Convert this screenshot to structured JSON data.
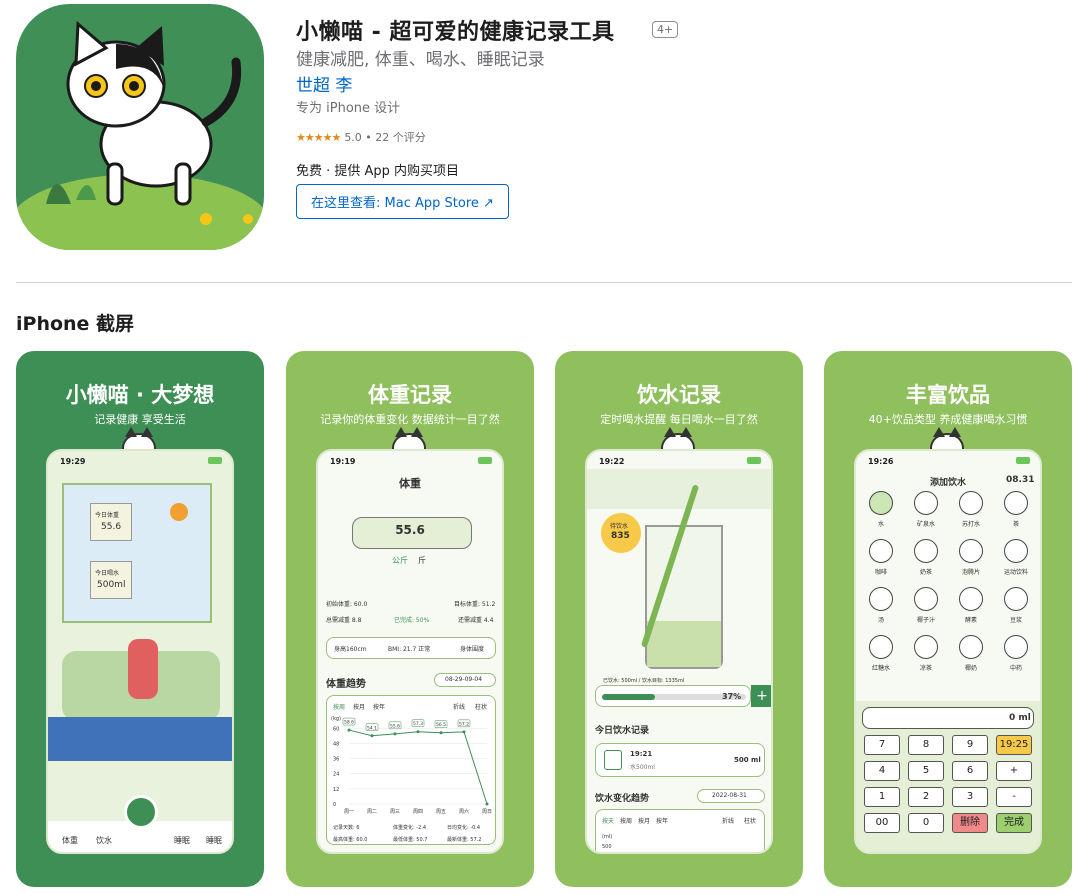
{
  "app": {
    "title": "小懒喵 - 超可爱的健康记录工具",
    "age_rating": "4+",
    "subtitle": "健康减肥, 体重、喝水、睡眠记录",
    "developer": "世超 李",
    "designed_for": "专为 iPhone 设计",
    "stars": "★★★★★",
    "rating_text": "5.0 • 22 个评分",
    "price_text": "免费 · 提供 App 内购买项目",
    "mac_store_button": "在这里查看: Mac App Store ↗"
  },
  "section_title": "iPhone 截屏",
  "screenshots": [
    {
      "title": "小懒喵 · 大梦想",
      "subtitle": "记录健康  享受生活",
      "time": "19:29",
      "note1_label": "今日体重",
      "note1_value": "55.6",
      "note2_label": "今日喝水",
      "note2_value": "500ml",
      "tabs": [
        "体重",
        "饮水",
        "",
        "睡眠",
        "睡眠"
      ]
    },
    {
      "title": "体重记录",
      "subtitle": "记录你的体重变化  数据统计一目了然",
      "time": "19:19",
      "header": "体重",
      "weight_value": "55.6",
      "unit_kg": "公斤",
      "unit_jin": "斤",
      "initial_weight": "初始体重: 60.0",
      "target_weight": "目标体重: 51.2",
      "total_loss": "总需减重 8.8",
      "remaining_loss": "还需减重 4.4",
      "completed": "已完成: 50%",
      "height": "身高160cm",
      "bmi": "BMI: 21.7 正常",
      "body_fat": "身体围度",
      "trend_title": "体重趋势",
      "trend_date": "08-29-09-04",
      "range_tabs": [
        "按周",
        "按月",
        "按年"
      ],
      "chart_tabs": [
        "折线",
        "柱状"
      ],
      "bottom_stats": [
        "记录天数: 6",
        "体重变化: -2.4",
        "日均变化: -0.4",
        "最高体重: 60.0",
        "最低体重: 50.7",
        "最新体重: 57.2"
      ]
    },
    {
      "title": "饮水记录",
      "subtitle": "定时喝水提醒  每日喝水一目了然",
      "time": "19:22",
      "bubble_label": "待饮水",
      "bubble_value": "835",
      "progress_text": "已饮水: 500ml / 饮水目标: 1335ml",
      "progress_pct": "37%",
      "today_title": "今日饮水记录",
      "record_time": "19:21",
      "record_name": "水500ml",
      "record_amount": "500 ml",
      "trend_title": "饮水变化趋势",
      "trend_date": "2022-08-31",
      "range_tabs": [
        "按天",
        "按周",
        "按月",
        "按年"
      ],
      "chart_tabs": [
        "折线",
        "柱状"
      ],
      "axis_unit": "(ml)",
      "axis_val": "500"
    },
    {
      "title": "丰富饮品",
      "subtitle": "40+饮品类型  养成健康喝水习惯",
      "time": "19:26",
      "header": "添加饮水",
      "date": "08.31",
      "drinks": [
        "水",
        "矿泉水",
        "苏打水",
        "茶",
        "咖啡",
        "奶茶",
        "泡腾片",
        "运动饮料",
        "汤",
        "椰子汁",
        "酵素",
        "豆浆",
        "红糖水",
        "凉茶",
        "椰奶",
        "中药"
      ],
      "amount": "0 ml",
      "keys": [
        "7",
        "8",
        "9",
        "19:25",
        "4",
        "5",
        "6",
        "+",
        "1",
        "2",
        "3",
        "-",
        "00",
        "0",
        "删除",
        "完成"
      ]
    }
  ],
  "colors": {
    "dark_green": "#3d8f55",
    "light_green": "#8fc05d",
    "link_blue": "#0066cc"
  },
  "chart_data": {
    "type": "line",
    "ylabel": "(kg)",
    "categories": [
      "周一",
      "周二",
      "周三",
      "周四",
      "周五",
      "周六",
      "周日"
    ],
    "values": [
      58.6,
      54.1,
      55.6,
      57.3,
      56.5,
      57.2,
      0
    ],
    "yticks": [
      0,
      12,
      24,
      36,
      48,
      60
    ],
    "ylim": [
      0,
      65
    ]
  }
}
